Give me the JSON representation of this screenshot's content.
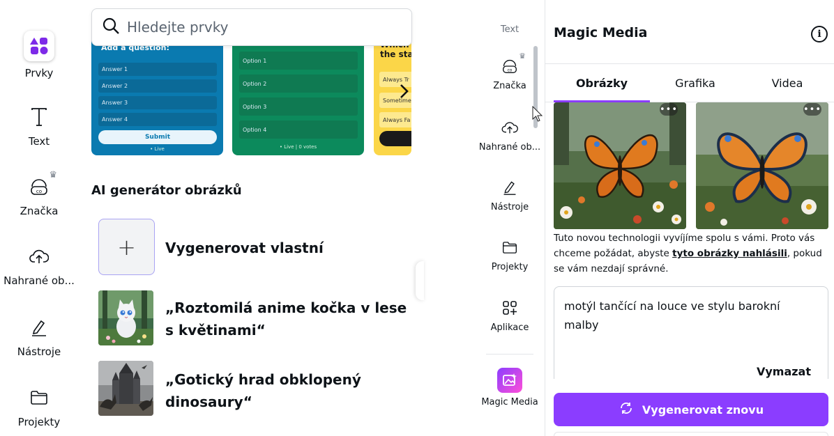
{
  "left_sidebar": {
    "items": [
      {
        "label": "Prvky",
        "icon": "elements-icon"
      },
      {
        "label": "Text",
        "icon": "text-icon"
      },
      {
        "label": "Značka",
        "icon": "brand-icon"
      },
      {
        "label": "Nahrané ob...",
        "icon": "upload-cloud-icon"
      },
      {
        "label": "Nástroje",
        "icon": "tools-icon"
      },
      {
        "label": "Projekty",
        "icon": "folder-icon"
      }
    ]
  },
  "search": {
    "placeholder": "Hledejte prvky"
  },
  "templates": {
    "blue": {
      "question": "Add a question:",
      "options": [
        "Answer 1",
        "Answer 2",
        "Answer 3",
        "Answer 4"
      ],
      "submit": "Submit",
      "live": "• Live"
    },
    "green": {
      "options": [
        "Option 1",
        "Option 2",
        "Option 3",
        "Option 4"
      ],
      "live": "• Live | 0 votes"
    },
    "yellow": {
      "title_line1": "Which st",
      "title_line2": "the stat",
      "options": [
        "Always Tr",
        "Sometime",
        "Always Fa"
      ]
    }
  },
  "ai_section": {
    "title": "AI generátor obrázků",
    "generate_own": "Vygenerovat vlastní",
    "suggestions": [
      {
        "line1": "„Roztomilá anime kočka v lese",
        "line2": "s květinami“"
      },
      {
        "line1": "„Gotický hrad obklopený",
        "line2": "dinosaury“"
      }
    ]
  },
  "right_sidebar": {
    "items": [
      {
        "label": "Text"
      },
      {
        "label": "Značka"
      },
      {
        "label": "Nahrané ob..."
      },
      {
        "label": "Nástroje"
      },
      {
        "label": "Projekty"
      },
      {
        "label": "Aplikace"
      },
      {
        "label": "Magic Media"
      }
    ]
  },
  "magic_media": {
    "title": "Magic Media",
    "tabs": [
      "Obrázky",
      "Grafika",
      "Videa"
    ],
    "active_tab": "Obrázky",
    "more_label": "•••",
    "disclaimer_before": "Tuto novou technologii vyvíjíme spolu s vámi. Proto vás chceme požádat, abyste ",
    "disclaimer_link": "tyto obrázky nahlásili",
    "disclaimer_after": ", pokud se vám nezdají správné.",
    "prompt": "motýl tančící na louce ve stylu barokní malby",
    "clear_label": "Vymazat",
    "regenerate_label": "Vygenerovat znovu",
    "accent": "#8b3dff"
  }
}
